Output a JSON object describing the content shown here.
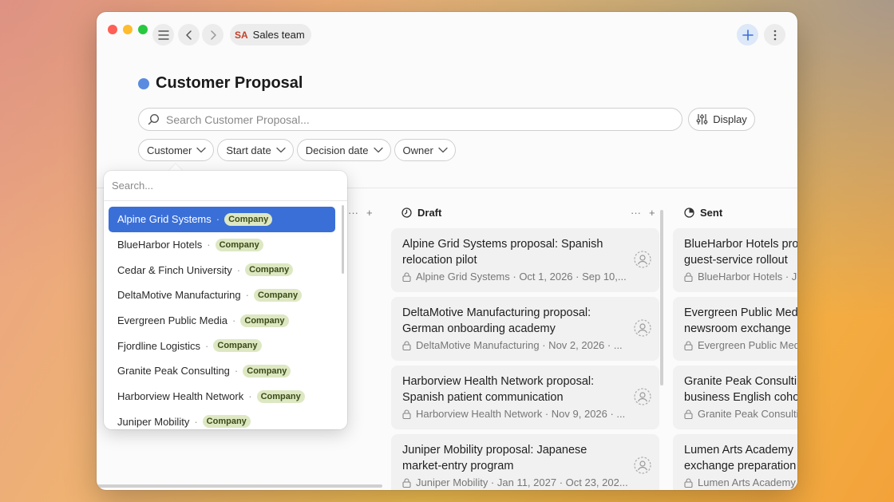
{
  "toolbar": {
    "team_abbr": "SA",
    "team_name": "Sales team"
  },
  "header": {
    "title": "Customer Proposal",
    "accent_color": "#5a8be0"
  },
  "search": {
    "placeholder": "Search Customer Proposal..."
  },
  "display_label": "Display",
  "filters": [
    "Customer",
    "Start date",
    "Decision date",
    "Owner"
  ],
  "columns": [
    {
      "name": "Draft",
      "cards": [
        {
          "title": "Alpine Grid Systems proposal: Spanish relocation pilot",
          "meta": "Alpine Grid Systems · Oct 1, 2026 · Sep 10,..."
        },
        {
          "title": "DeltaMotive Manufacturing proposal: German onboarding academy",
          "meta": "DeltaMotive Manufacturing · Nov 2, 2026 · ..."
        },
        {
          "title": "Harborview Health Network proposal: Spanish patient communication",
          "meta": "Harborview Health Network · Nov 9, 2026 · ..."
        },
        {
          "title": "Juniper Mobility proposal: Japanese market-entry program",
          "meta": "Juniper Mobility · Jan 11, 2027 · Oct 23, 202..."
        }
      ]
    },
    {
      "name": "Sent",
      "cards": [
        {
          "title1": "BlueHarbor Hotels pro",
          "title2": "guest-service rollout",
          "meta": "BlueHarbor Hotels · J"
        },
        {
          "title1": "Evergreen Public Med",
          "title2": "newsroom exchange",
          "meta": "Evergreen Public Med"
        },
        {
          "title1": "Granite Peak Consultin",
          "title2": "business English coho",
          "meta": "Granite Peak Consulti"
        },
        {
          "title1": "Lumen Arts Academy",
          "title2": "exchange preparation",
          "meta": "Lumen Arts Academy"
        }
      ]
    }
  ],
  "dropdown": {
    "placeholder": "Search...",
    "badge": "Company",
    "items": [
      "Alpine Grid Systems",
      "BlueHarbor Hotels",
      "Cedar & Finch University",
      "DeltaMotive Manufacturing",
      "Evergreen Public Media",
      "Fjordline Logistics",
      "Granite Peak Consulting",
      "Harborview Health Network",
      "Juniper Mobility"
    ]
  }
}
